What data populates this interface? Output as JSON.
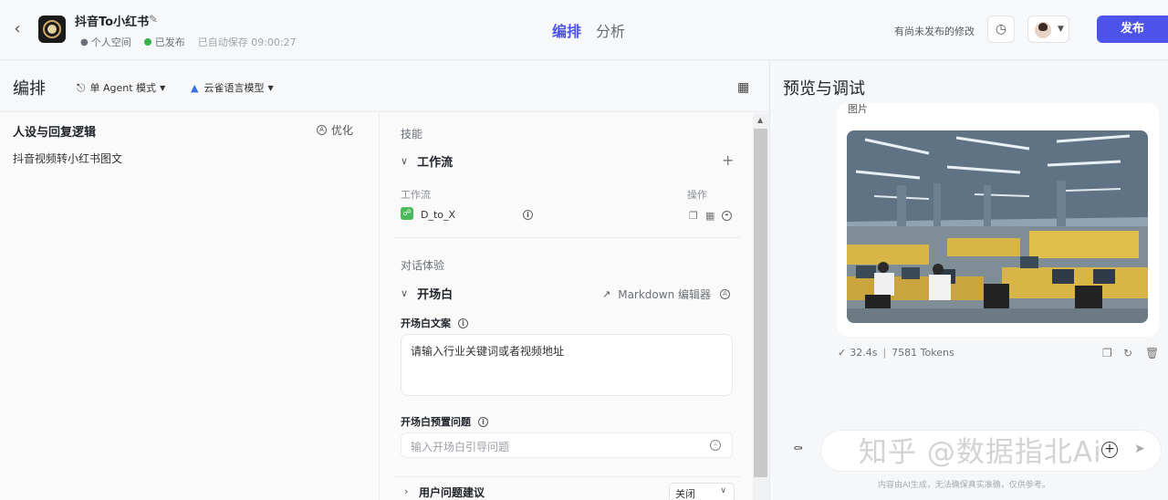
{
  "header": {
    "app_title": "抖音To小红书",
    "space": "个人空间",
    "status": "已发布",
    "autosave": "已自动保存 09:00:27",
    "tabs": [
      {
        "label": "编排",
        "active": true
      },
      {
        "label": "分析",
        "active": false
      }
    ],
    "unpublished": "有尚未发布的修改",
    "publish_label": "发布",
    "accent_color": "#4d53e8"
  },
  "edit_panel": {
    "title": "编排",
    "mode": "单 Agent 模式",
    "model": "云雀语言模型",
    "persona": {
      "title": "人设与回复逻辑",
      "optimize_label": "优化",
      "content": "抖音视频转小红书图文"
    },
    "skills": {
      "section_label": "技能",
      "workflow_group": "工作流",
      "col_workflow": "工作流",
      "col_actions": "操作",
      "workflow_name": "D_to_X"
    },
    "dialog": {
      "section_label": "对话体验",
      "opening_group": "开场白",
      "markdown_label": "Markdown 编辑器",
      "opening_text_label": "开场白文案",
      "opening_text_value": "请输入行业关键词或者视频地址",
      "preset_label": "开场白预置问题",
      "preset_placeholder": "输入开场白引导问题",
      "suggest_label": "用户问题建议",
      "suggest_value": "关闭"
    }
  },
  "preview": {
    "title": "预览与调试",
    "bubble_label": "图片",
    "duration": "32.4s",
    "tokens": "7581 Tokens",
    "disclaimer": "内容由AI生成，无法确保真实准确，仅供参考。",
    "watermark": "知乎 @数据指北Ai"
  }
}
